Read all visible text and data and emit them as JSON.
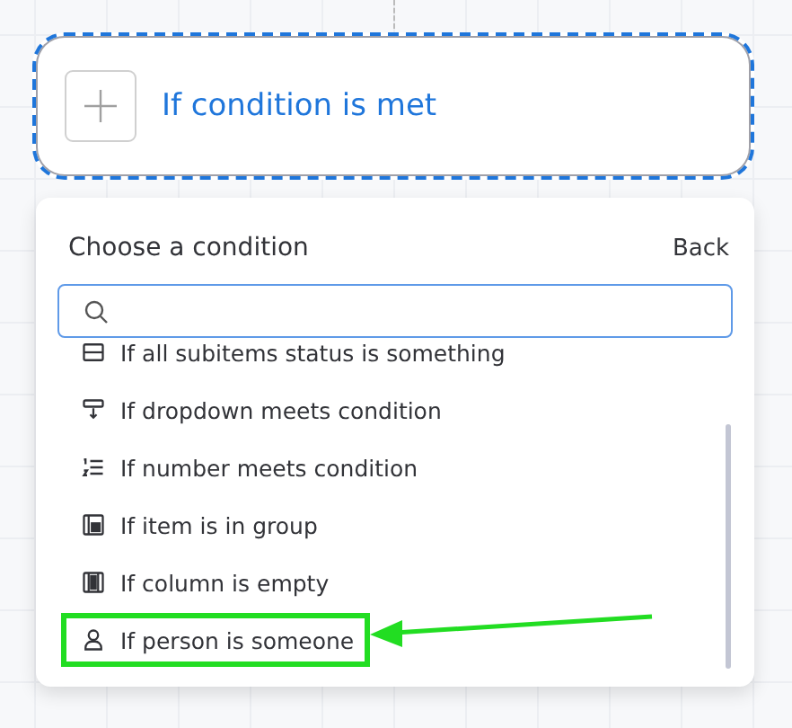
{
  "node": {
    "title": "If condition is met",
    "selected": true
  },
  "panel": {
    "title": "Choose a condition",
    "back": "Back"
  },
  "conditions": [
    {
      "kind": "subitems",
      "label": "If all subitems status is something",
      "highlighted": false
    },
    {
      "kind": "dropdown",
      "label": "If dropdown meets condition",
      "highlighted": false
    },
    {
      "kind": "number",
      "label": "If number meets condition",
      "highlighted": false
    },
    {
      "kind": "group",
      "label": "If item is in group",
      "highlighted": false
    },
    {
      "kind": "column",
      "label": "If column is empty",
      "highlighted": false
    },
    {
      "kind": "person",
      "label": "If person is someone",
      "highlighted": true
    }
  ]
}
